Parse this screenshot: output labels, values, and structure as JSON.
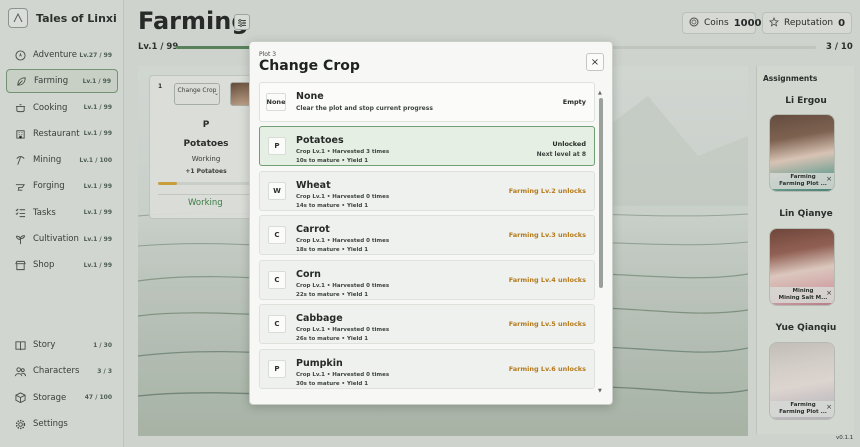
{
  "app": {
    "title": "Tales of Linxi",
    "version": "v0.1.1"
  },
  "colors": {
    "accent": "#5f8f62",
    "warning": "#b57a1c",
    "working": "#3e8a47"
  },
  "sidebar": {
    "items": [
      {
        "label": "Adventure",
        "level": "Lv.27 / 99",
        "icon": "compass-icon"
      },
      {
        "label": "Farming",
        "level": "Lv.1 / 99",
        "icon": "leaf-icon",
        "active": true
      },
      {
        "label": "Cooking",
        "level": "Lv.1 / 99",
        "icon": "pot-icon"
      },
      {
        "label": "Restaurant",
        "level": "Lv.1 / 99",
        "icon": "building-icon"
      },
      {
        "label": "Mining",
        "level": "Lv.1 / 100",
        "icon": "pickaxe-icon"
      },
      {
        "label": "Forging",
        "level": "Lv.1 / 99",
        "icon": "anvil-icon"
      },
      {
        "label": "Tasks",
        "level": "Lv.1 / 99",
        "icon": "checklist-icon"
      },
      {
        "label": "Cultivation",
        "level": "Lv.1 / 99",
        "icon": "sprout-icon"
      },
      {
        "label": "Shop",
        "level": "Lv.1 / 99",
        "icon": "store-icon"
      }
    ],
    "bottom": [
      {
        "label": "Story",
        "count": "1 / 30",
        "icon": "book-icon"
      },
      {
        "label": "Characters",
        "count": "3 / 3",
        "icon": "people-icon"
      },
      {
        "label": "Storage",
        "count": "47 / 100",
        "icon": "box-icon"
      },
      {
        "label": "Settings",
        "count": "",
        "icon": "gear-icon"
      }
    ]
  },
  "header": {
    "title": "Farming",
    "coins_label": "Coins",
    "coins_value": "1000",
    "reputation_label": "Reputation",
    "reputation_value": "0",
    "level": "Lv.1 / 99",
    "xp_progress": 0.12,
    "plots": "3 / 10"
  },
  "plot": {
    "number": "1",
    "change_crop": "Change Crop",
    "letter": "P",
    "crop": "Potatoes",
    "status": "Working",
    "yield": "+1 Potatoes",
    "progress": 0.2,
    "working_label": "Working"
  },
  "assignments": {
    "title": "Assignments",
    "people": [
      {
        "name": "Li Ergou",
        "role": "Farming",
        "task": "Farming Plot ..."
      },
      {
        "name": "Lin Qianye",
        "role": "Mining",
        "task": "Mining Salt M..."
      },
      {
        "name": "Yue Qianqiu",
        "role": "Farming",
        "task": "Farming Plot ..."
      }
    ]
  },
  "modal": {
    "subtitle": "Plot 3",
    "title": "Change Crop",
    "close": "×",
    "none": {
      "badge": "None",
      "name": "None",
      "desc": "Clear the plot and stop current progress",
      "status": "Empty"
    },
    "crops": [
      {
        "badge": "P",
        "name": "Potatoes",
        "line1": "Crop Lv.1 • Harvested 3 times",
        "line2": "10s to mature • Yield 1",
        "status": "Unlocked",
        "status2": "Next level at 8"
      },
      {
        "badge": "W",
        "name": "Wheat",
        "line1": "Crop Lv.1 • Harvested 0 times",
        "line2": "14s to mature • Yield 1",
        "status": "Farming Lv.2 unlocks"
      },
      {
        "badge": "C",
        "name": "Carrot",
        "line1": "Crop Lv.1 • Harvested 0 times",
        "line2": "18s to mature • Yield 1",
        "status": "Farming Lv.3 unlocks"
      },
      {
        "badge": "C",
        "name": "Corn",
        "line1": "Crop Lv.1 • Harvested 0 times",
        "line2": "22s to mature • Yield 1",
        "status": "Farming Lv.4 unlocks"
      },
      {
        "badge": "C",
        "name": "Cabbage",
        "line1": "Crop Lv.1 • Harvested 0 times",
        "line2": "26s to mature • Yield 1",
        "status": "Farming Lv.5 unlocks"
      },
      {
        "badge": "P",
        "name": "Pumpkin",
        "line1": "Crop Lv.1 • Harvested 0 times",
        "line2": "30s to mature • Yield 1",
        "status": "Farming Lv.6 unlocks"
      }
    ]
  }
}
